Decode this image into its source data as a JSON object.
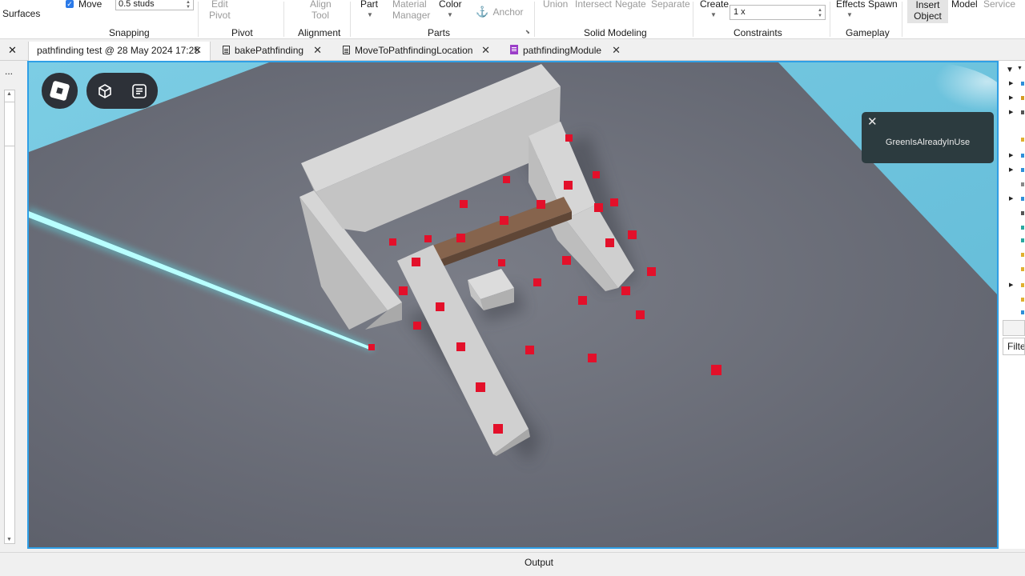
{
  "ribbon": {
    "surfaces_label": "Surfaces",
    "move_label": "Move",
    "snap_value": "0.5 studs",
    "edit_pivot_label_1": "Edit",
    "edit_pivot_label_2": "Pivot",
    "align_tool_label_1": "Align",
    "align_tool_label_2": "Tool",
    "part_label": "Part",
    "material_manager_label_1": "Material",
    "material_manager_label_2": "Manager",
    "color_label": "Color",
    "anchor_label": "Anchor",
    "union_label": "Union",
    "intersect_label": "Intersect",
    "negate_label": "Negate",
    "separate_label": "Separate",
    "create_label": "Create",
    "constraints_value": "1 x",
    "effects_label": "Effects",
    "spawn_label": "Spawn",
    "insert_object_label_1": "Insert",
    "insert_object_label_2": "Object",
    "model_label": "Model",
    "service_label": "Service",
    "groups": {
      "snapping": "Snapping",
      "pivot": "Pivot",
      "alignment": "Alignment",
      "parts": "Parts",
      "solid_modeling": "Solid Modeling",
      "constraints": "Constraints",
      "gameplay": "Gameplay"
    }
  },
  "tabs": [
    {
      "label": "pathfinding test @ 28 May 2024 17:25",
      "active": true
    },
    {
      "label": "bakePathfinding",
      "icon": "script-icon"
    },
    {
      "label": "MoveToPathfindingLocation",
      "icon": "script-icon"
    },
    {
      "label": "pathfindingModule",
      "icon": "module-script-icon"
    }
  ],
  "left_strip": {
    "more_label": "..."
  },
  "viewport": {
    "toast_message": "GreenIsAlreadyInUse",
    "colors": {
      "sky": "#6ec6df",
      "baseplate": "#6a6d78",
      "wall": "#c9c9c9",
      "wood_beam": "#7a5a45",
      "waypoint": "#e3102a",
      "laser": "#2ff2ff"
    }
  },
  "right_panel": {
    "filter_placeholder": "Filte"
  },
  "output": {
    "label": "Output"
  }
}
